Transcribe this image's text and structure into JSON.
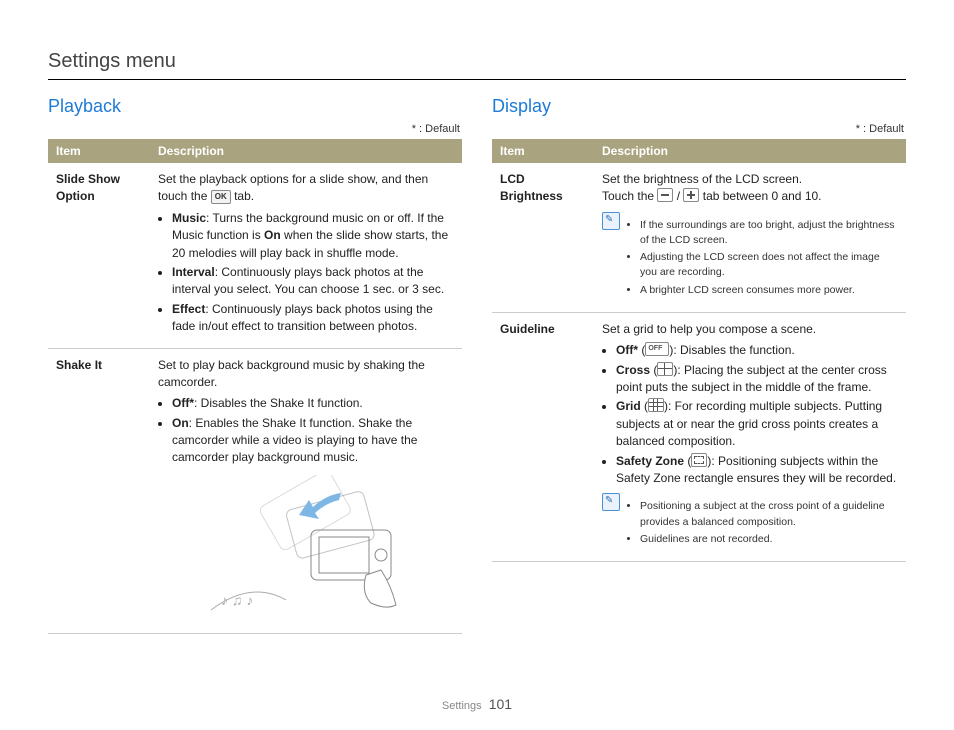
{
  "page_title": "Settings menu",
  "default_legend": "* : Default",
  "footer": {
    "section": "Settings",
    "page": "101"
  },
  "playback": {
    "heading": "Playback",
    "columns": {
      "item": "Item",
      "desc": "Description"
    },
    "rows": [
      {
        "item": "Slide Show Option",
        "intro_a": "Set the playback options for a slide show, and then touch the ",
        "ok_label": "OK",
        "intro_b": " tab.",
        "bullets": {
          "music_label": "Music",
          "music_text": ": Turns the background music on or off. If the Music function is ",
          "music_on": "On",
          "music_text2": " when the slide show starts, the 20 melodies will play back in shuffle mode.",
          "interval_label": "Interval",
          "interval_text": ": Continuously plays back photos at the interval you select. You can choose 1 sec. or 3 sec.",
          "effect_label": "Effect",
          "effect_text": ": Continuously plays back photos using the fade in/out effect to transition between photos."
        }
      },
      {
        "item": "Shake It",
        "intro": "Set to play back background music by shaking the camcorder.",
        "bullets": {
          "off_label": "Off*",
          "off_text": ": Disables the Shake It function.",
          "on_label": "On",
          "on_text": ":  Enables the Shake It function. Shake the camcorder while a video is playing to have the camcorder play background music."
        }
      }
    ]
  },
  "display": {
    "heading": "Display",
    "columns": {
      "item": "Item",
      "desc": "Description"
    },
    "rows": [
      {
        "item": "LCD Brightness",
        "intro": "Set the brightness of the LCD screen.",
        "line2a": "Touch the ",
        "line2b": " / ",
        "line2c": " tab between 0 and 10.",
        "notes": [
          "If the surroundings are too bright, adjust the brightness of the LCD screen.",
          "Adjusting the LCD screen does not affect the image you are recording.",
          "A brighter LCD screen consumes more power."
        ]
      },
      {
        "item": "Guideline",
        "intro": "Set a grid to help you compose a scene.",
        "bullets": {
          "off_label": "Off*",
          "off_text": "): Disables the function.",
          "cross_label": "Cross",
          "cross_text": "): Placing the subject at the center cross point puts the subject in the middle of the frame.",
          "grid_label": "Grid",
          "grid_text": "): For recording multiple subjects. Putting subjects at or near the grid cross points creates a balanced composition.",
          "safety_label": "Safety Zone",
          "safety_text": "): Positioning subjects within the Safety Zone rectangle ensures they will be recorded."
        },
        "notes": [
          "Positioning a subject at the cross point of a guideline provides a balanced composition.",
          "Guidelines are not recorded."
        ]
      }
    ]
  }
}
